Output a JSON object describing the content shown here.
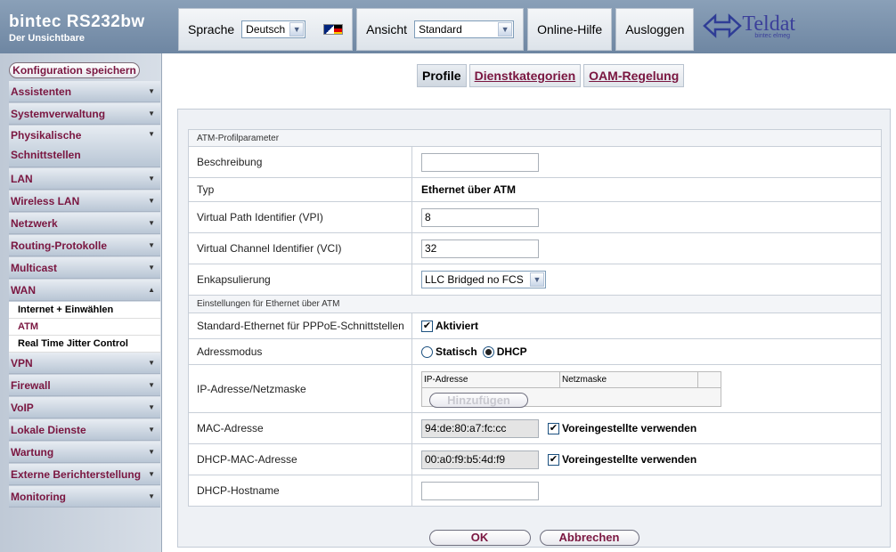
{
  "header": {
    "product": "bintec  RS232bw",
    "subtitle": "Der Unsichtbare",
    "language_label": "Sprache",
    "language_value": "Deutsch",
    "view_label": "Ansicht",
    "view_value": "Standard",
    "help": "Online-Hilfe",
    "logout": "Ausloggen",
    "logo_text": "Teldat",
    "logo_subtext": "bintec elmeg"
  },
  "sidebar": {
    "save": "Konfiguration speichern",
    "items": [
      {
        "label": "Assistenten"
      },
      {
        "label": "Systemverwaltung"
      },
      {
        "label": "Physikalische Schnittstellen"
      },
      {
        "label": "LAN"
      },
      {
        "label": "Wireless LAN"
      },
      {
        "label": "Netzwerk"
      },
      {
        "label": "Routing-Protokolle"
      },
      {
        "label": "Multicast"
      },
      {
        "label": "WAN"
      },
      {
        "label": "VPN"
      },
      {
        "label": "Firewall"
      },
      {
        "label": "VoIP"
      },
      {
        "label": "Lokale Dienste"
      },
      {
        "label": "Wartung"
      },
      {
        "label": "Externe Berichterstellung"
      },
      {
        "label": "Monitoring"
      }
    ],
    "wan_sub": [
      "Internet + Einwählen",
      "ATM",
      "Real Time Jitter Control"
    ]
  },
  "tabs": [
    "Profile",
    "Dienstkategorien",
    "OAM-Regelung"
  ],
  "form": {
    "section1": "ATM-Profilparameter",
    "beschreibung_label": "Beschreibung",
    "beschreibung_value": "",
    "typ_label": "Typ",
    "typ_value": "Ethernet über ATM",
    "vpi_label": "Virtual Path Identifier (VPI)",
    "vpi_value": "8",
    "vci_label": "Virtual Channel Identifier (VCI)",
    "vci_value": "32",
    "enkap_label": "Enkapsulierung",
    "enkap_value": "LLC Bridged no FCS",
    "section2": "Einstellungen für Ethernet über ATM",
    "std_eth_label": "Standard-Ethernet für PPPoE-Schnittstellen",
    "std_eth_value": "Aktiviert",
    "adressmodus_label": "Adressmodus",
    "radio_statisch": "Statisch",
    "radio_dhcp": "DHCP",
    "ip_label": "IP-Adresse/Netzmaske",
    "ip_col1": "IP-Adresse",
    "ip_col2": "Netzmaske",
    "add_button": "Hinzufügen",
    "mac_label": "MAC-Adresse",
    "mac_value": "94:de:80:a7:fc:cc",
    "mac_default": "Voreingestellte verwenden",
    "dhcp_mac_label": "DHCP-MAC-Adresse",
    "dhcp_mac_value": "00:a0:f9:b5:4d:f9",
    "dhcp_mac_default": "Voreingestellte verwenden",
    "hostname_label": "DHCP-Hostname",
    "hostname_value": ""
  },
  "buttons": {
    "ok": "OK",
    "cancel": "Abbrechen"
  },
  "colors": {
    "accent": "#7a1640",
    "header_bg": "#7f95af"
  }
}
